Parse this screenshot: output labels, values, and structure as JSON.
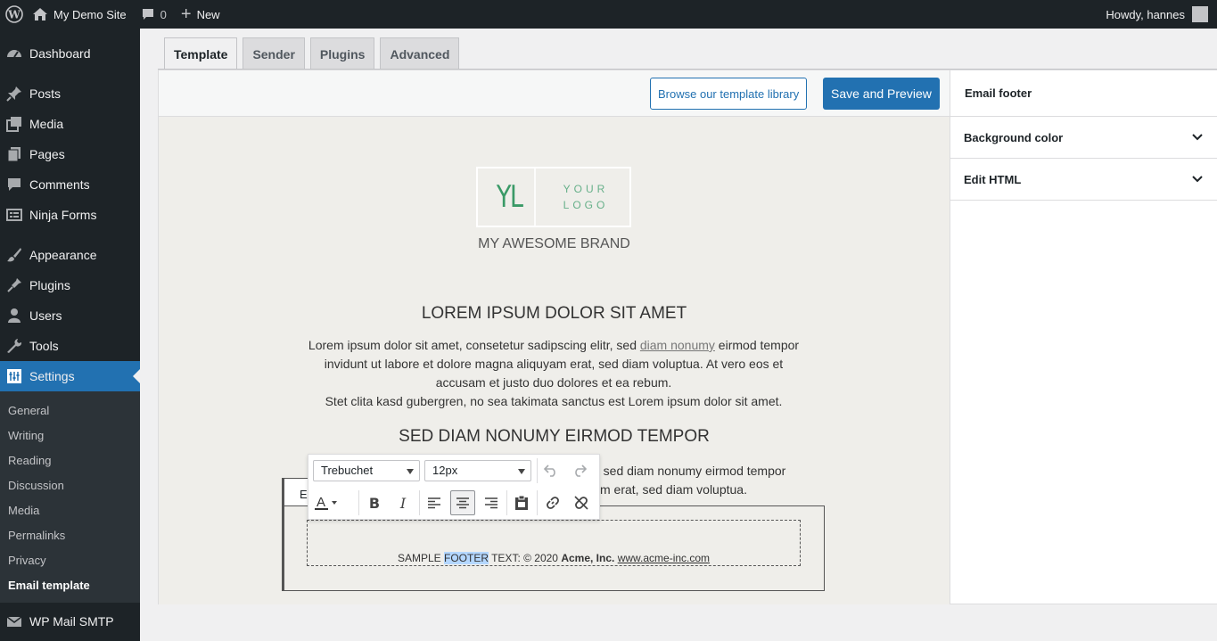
{
  "adminbar": {
    "site_name": "My Demo Site",
    "comments_count": "0",
    "new_label": "New",
    "greeting": "Howdy, hannes"
  },
  "sidebar": {
    "items": [
      {
        "label": "Dashboard",
        "icon": "dashboard-icon"
      },
      {
        "label": "Posts",
        "icon": "pin-icon"
      },
      {
        "label": "Media",
        "icon": "media-icon"
      },
      {
        "label": "Pages",
        "icon": "pages-icon"
      },
      {
        "label": "Comments",
        "icon": "comment-icon"
      },
      {
        "label": "Ninja Forms",
        "icon": "forms-icon"
      },
      {
        "label": "Appearance",
        "icon": "brush-icon"
      },
      {
        "label": "Plugins",
        "icon": "plugin-icon"
      },
      {
        "label": "Users",
        "icon": "user-icon"
      },
      {
        "label": "Tools",
        "icon": "wrench-icon"
      },
      {
        "label": "Settings",
        "icon": "settings-icon"
      },
      {
        "label": "WP Mail SMTP",
        "icon": "mail-icon"
      }
    ],
    "submenu": [
      "General",
      "Writing",
      "Reading",
      "Discussion",
      "Media",
      "Permalinks",
      "Privacy",
      "Email template"
    ]
  },
  "tabs": [
    "Template",
    "Sender",
    "Plugins",
    "Advanced"
  ],
  "topbar": {
    "browse_label": "Browse our template library",
    "save_label": "Save and Preview"
  },
  "email": {
    "logo_initials": "YL",
    "logo_text_1": "YOUR",
    "logo_text_2": "LOGO",
    "brand": "MY AWESOME BRAND",
    "heading1": "LOREM IPSUM DOLOR SIT AMET",
    "para1_a": "Lorem ipsum dolor sit amet, consetetur sadipscing elitr, sed ",
    "para1_link": "diam nonumy",
    "para1_b": " eirmod tempor invidunt ut labore et dolore magna aliquyam erat, sed diam voluptua. At vero eos et accusam et justo duo dolores et ea rebum.",
    "para1_c": "Stet clita kasd gubergren, no sea takimata sanctus est Lorem ipsum dolor sit amet.",
    "heading2": "SED DIAM NONUMY EIRMOD TEMPOR",
    "para2_line1": "itr, sed diam nonumy eirmod tempor",
    "para2_line2": "m erat, sed diam voluptua.",
    "footer_tab_letter": "E",
    "footer_pre": "SAMPLE ",
    "footer_sel": "FOOTER",
    "footer_mid": " TEXT: © 2020 ",
    "footer_bold": "Acme, Inc.",
    "footer_link": "www.acme-inc.com"
  },
  "toolbar": {
    "font_family": "Trebuchet",
    "font_size": "12px"
  },
  "side_panel": {
    "title": "Email footer",
    "sections": [
      "Background color",
      "Edit HTML"
    ]
  }
}
